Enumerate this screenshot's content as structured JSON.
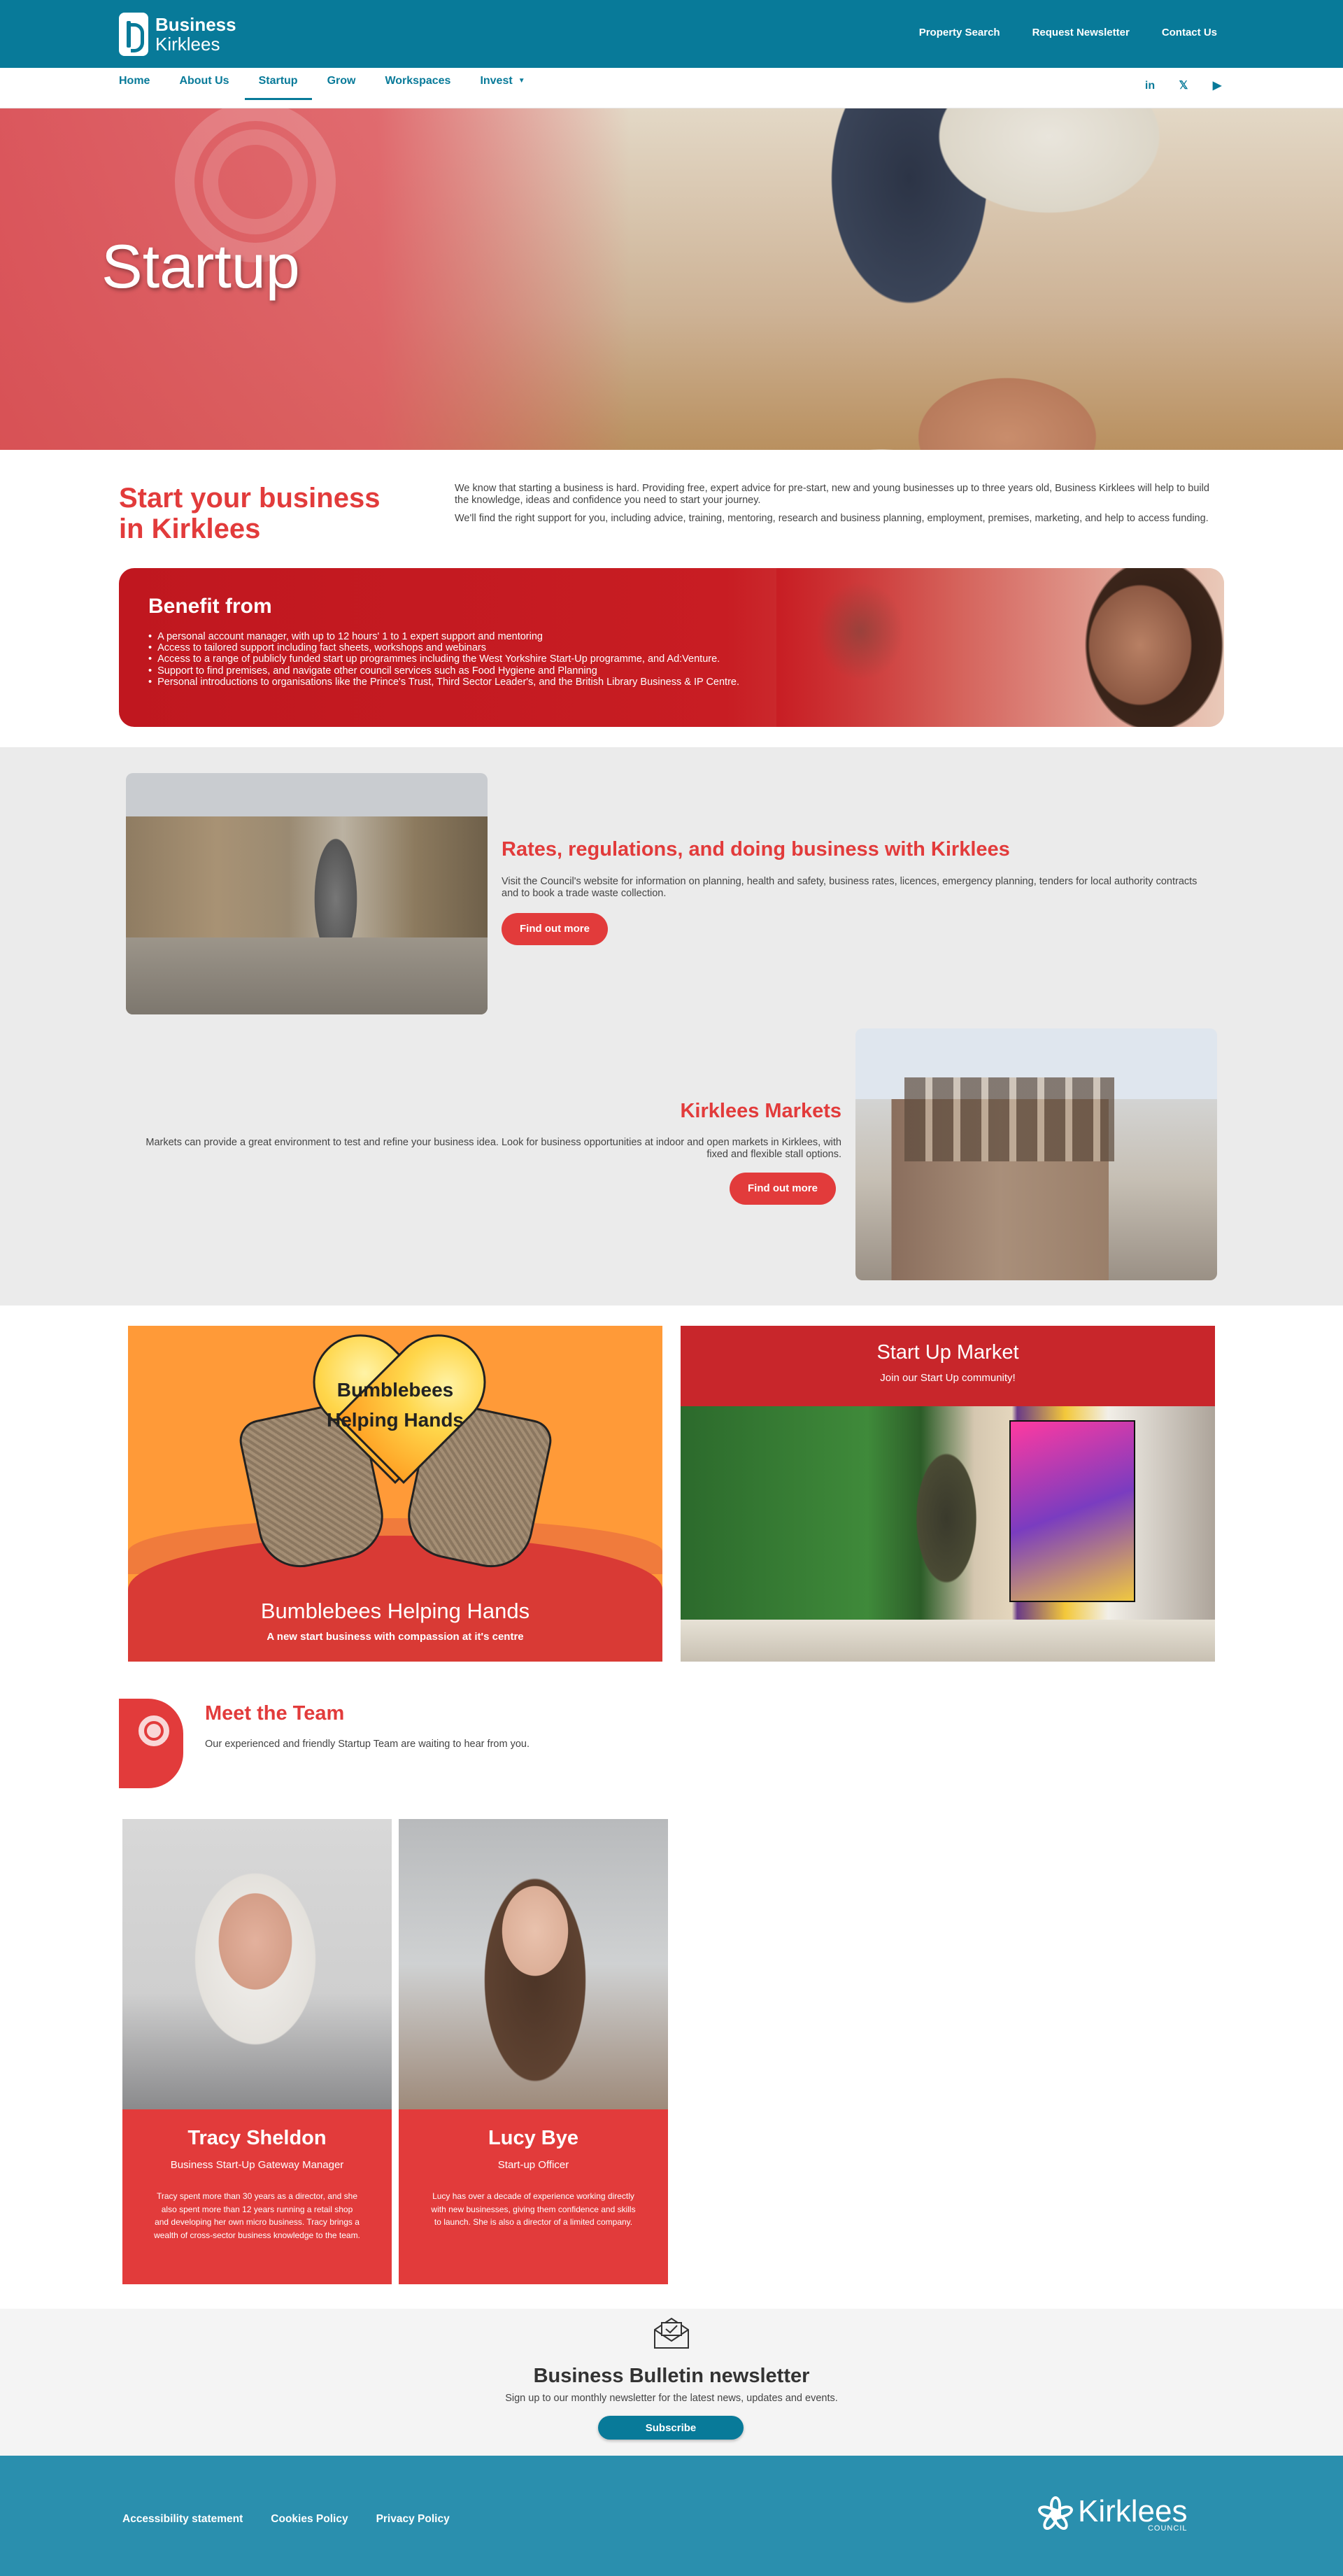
{
  "brand": {
    "line1": "Business",
    "line2": "Kirklees"
  },
  "top_links": [
    "Property Search",
    "Request Newsletter",
    "Contact Us"
  ],
  "nav": {
    "items": [
      "Home",
      "About Us",
      "Startup",
      "Grow",
      "Workspaces",
      "Invest"
    ],
    "active": "Startup",
    "socials": [
      "linkedin-icon",
      "x-icon",
      "youtube-icon"
    ]
  },
  "hero": {
    "title": "Startup"
  },
  "intro": {
    "title": "Start your business in Kirklees",
    "p1": "We know that starting a business is hard. Providing free, expert advice for pre-start, new and young businesses up to three years old, Business Kirklees will help to build the knowledge, ideas and confidence you need to start your journey.",
    "p2": "We'll find the right support for you, including advice, training, mentoring, research and business planning, employment, premises, marketing, and help to access funding."
  },
  "benefit": {
    "title": "Benefit from",
    "items": [
      "A personal account manager, with up to 12 hours' 1 to 1 expert support and mentoring",
      "Access to tailored support including fact sheets, workshops and webinars",
      "Access to a range of publicly funded start up programmes including the West Yorkshire Start-Up programme, and Ad:Venture.",
      "Support to find premises, and navigate other council services such as Food Hygiene and Planning",
      "Personal introductions to organisations like the Prince's Trust, Third Sector Leader's, and the British Library Business & IP Centre."
    ]
  },
  "rates": {
    "title": "Rates, regulations, and doing business with Kirklees",
    "text": "Visit the Council's website for information on planning, health and safety, business rates, licences, emergency planning, tenders for local authority contracts and to book a trade waste collection.",
    "button": "Find out more"
  },
  "markets": {
    "title": "Kirklees Markets",
    "text": "Markets can provide a great environment to test and refine your business idea. Look for business opportunities at indoor and open markets in Kirklees, with fixed and flexible stall options.",
    "button": "Find out more"
  },
  "tiles": {
    "bees": {
      "heart_line1": "Bumblebees",
      "heart_line2": "Helping Hands",
      "title": "Bumblebees Helping Hands",
      "subtitle": "A new start business with compassion at it's centre"
    },
    "startup_market": {
      "title": "Start Up Market",
      "subtitle": "Join our Start Up community!"
    }
  },
  "team": {
    "title": "Meet the Team",
    "subtitle": "Our experienced and friendly Startup Team are waiting to hear from you.",
    "members": [
      {
        "name": "Tracy Sheldon",
        "role": "Business Start-Up Gateway Manager",
        "bio": "Tracy spent more than 30 years as a director, and she also spent more than 12 years running a retail shop and developing her own micro business.  Tracy brings a wealth of cross-sector business knowledge to the team."
      },
      {
        "name": "Lucy Bye",
        "role": "Start-up Officer",
        "bio": "Lucy has over a decade of experience working directly with new businesses, giving them confidence and skills to launch. She is also a director of a limited company."
      }
    ]
  },
  "newsletter": {
    "title": "Business Bulletin newsletter",
    "subtitle": "Sign up to our monthly newsletter for the latest news, updates and events.",
    "button": "Subscribe"
  },
  "footer": {
    "links": [
      "Accessibility statement",
      "Cookies Policy",
      "Privacy Policy"
    ],
    "logo_name": "Kirklees",
    "logo_sub": "COUNCIL"
  },
  "colors": {
    "teal": "#087a99",
    "red": "#e23b3b",
    "footer": "#2a8fae"
  }
}
